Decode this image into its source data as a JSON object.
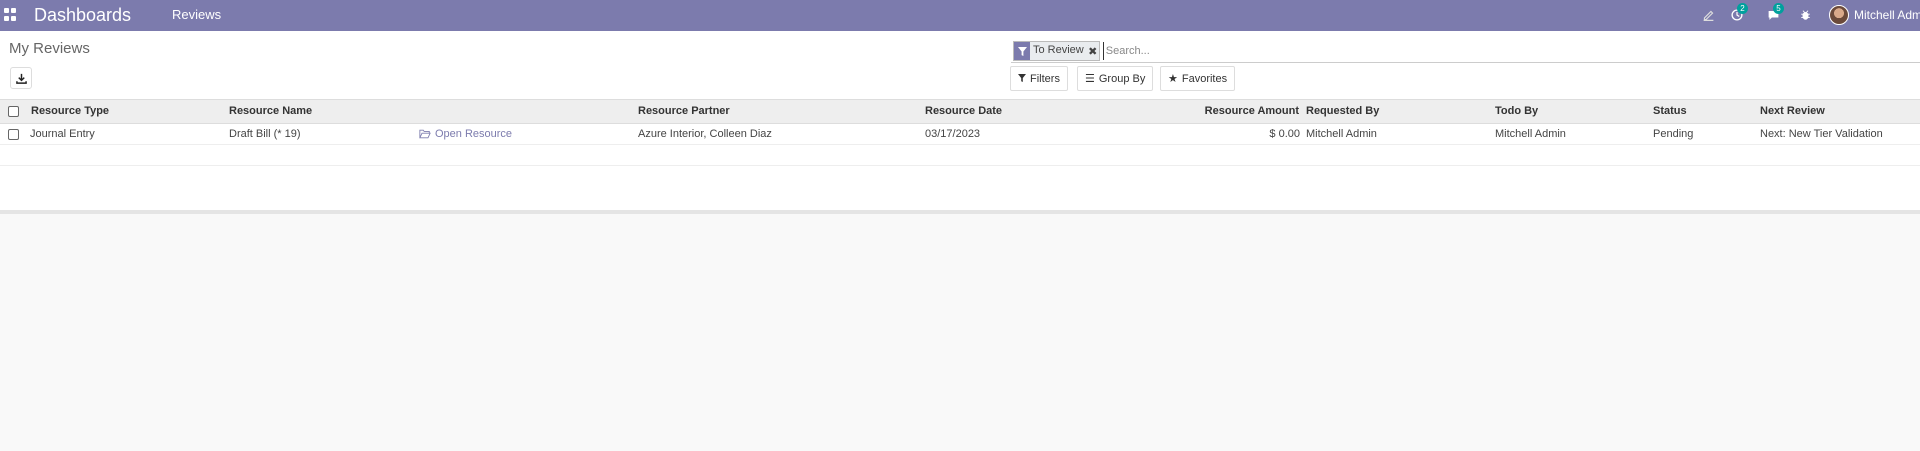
{
  "navbar": {
    "brand": "Dashboards",
    "menu_reviews": "Reviews",
    "activity_badge": "2",
    "messages_badge": "5",
    "user_name": "Mitchell Admin",
    "color": "#7c7bad"
  },
  "control": {
    "title": "My Reviews",
    "facet_label": "To Review",
    "search_placeholder": "Search...",
    "filters_label": "Filters",
    "groupby_label": "Group By",
    "favorites_label": "Favorites"
  },
  "table": {
    "headers": {
      "resource_type": "Resource Type",
      "resource_name": "Resource Name",
      "resource_partner": "Resource Partner",
      "resource_date": "Resource Date",
      "resource_amount": "Resource Amount",
      "requested_by": "Requested By",
      "todo_by": "Todo By",
      "status": "Status",
      "next_review": "Next Review"
    },
    "rows": [
      {
        "resource_type": "Journal Entry",
        "resource_name": "Draft Bill (* 19)",
        "open_resource": "Open Resource",
        "resource_partner": "Azure Interior, Colleen Diaz",
        "resource_date": "03/17/2023",
        "resource_amount": "$ 0.00",
        "requested_by": "Mitchell Admin",
        "todo_by": "Mitchell Admin",
        "status": "Pending",
        "next_review": "Next: New Tier Validation"
      }
    ]
  }
}
